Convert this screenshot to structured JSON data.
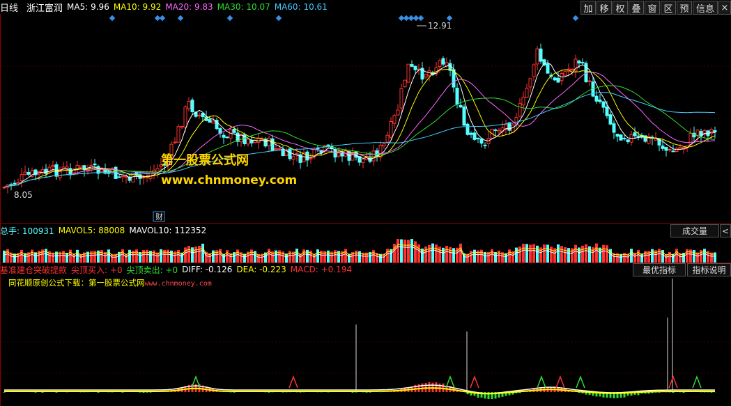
{
  "top_bar": {
    "period": "日线",
    "stock_name": "浙江富润",
    "ma5": {
      "label": "MA5:",
      "value": "9.96",
      "color": "#ffffff"
    },
    "ma10": {
      "label": "MA10:",
      "value": "9.92",
      "color": "#ffff00"
    },
    "ma20": {
      "label": "MA20:",
      "value": "9.83",
      "color": "#ff66ff"
    },
    "ma30": {
      "label": "MA30:",
      "value": "10.07",
      "color": "#33dd33"
    },
    "ma60": {
      "label": "MA60:",
      "value": "10.61",
      "color": "#44ccff"
    }
  },
  "toolbar": {
    "add": "加",
    "move": "移",
    "authority": "权",
    "overlay": "叠",
    "window": "窗",
    "section": "区",
    "forecast": "预",
    "info": "信息"
  },
  "price_panel": {
    "high_label": "12.91",
    "low_label": "8.05",
    "finance_marker": "财",
    "watermark_cn": "第一股票公式网",
    "watermark_url": "www.chnmoney.com",
    "colors": {
      "up": "#ff3232",
      "down": "#54ffff",
      "marker": "#3a8ee6"
    }
  },
  "volume_panel": {
    "total_label": "总手:",
    "total_value": "100931",
    "mavol5_label": "MAVOL5:",
    "mavol5_value": "88008",
    "mavol10_label": "MAVOL10:",
    "mavol10_value": "112352",
    "indicator_button": "成交量"
  },
  "indicator_panel": {
    "name": "基准建仓突破提款",
    "buy_label": "尖顶买入:",
    "buy_value": "+0",
    "sell_label": "尖顶卖出:",
    "sell_value": "+0",
    "diff_label": "DIFF:",
    "diff_value": "-0.126",
    "dea_label": "DEA:",
    "dea_value": "-0.223",
    "macd_label": "MACD:",
    "macd_value": "+0.194",
    "best_button": "最优指标",
    "explain_button": "指标说明",
    "source_note": "同花顺原创公式下载：第一股票公式网",
    "source_url": "www.chnmoney.com"
  }
}
